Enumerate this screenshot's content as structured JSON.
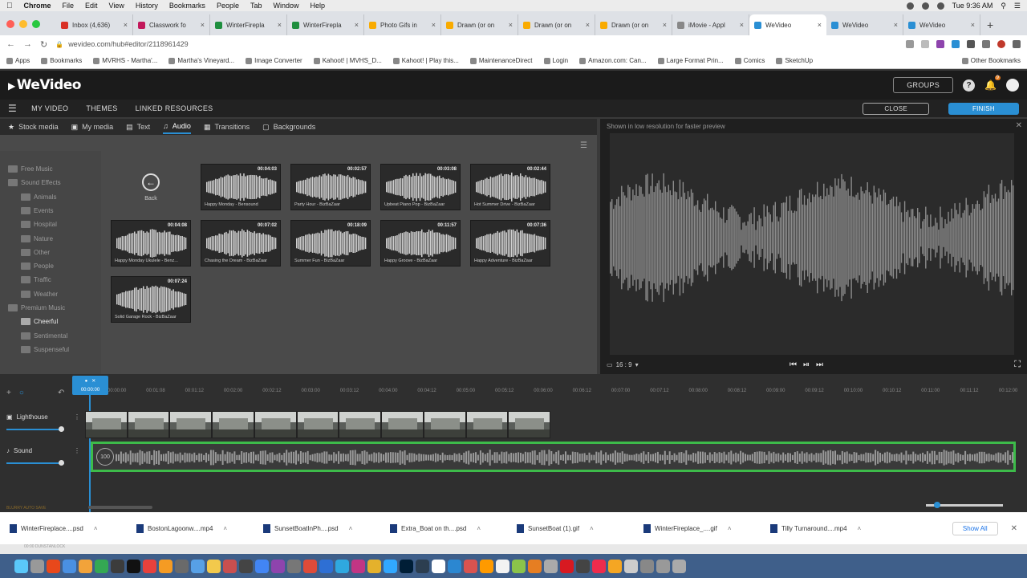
{
  "mac": {
    "app": "Chrome",
    "menus": [
      "File",
      "Edit",
      "View",
      "History",
      "Bookmarks",
      "People",
      "Tab",
      "Window",
      "Help"
    ],
    "clock": "Tue 9:36 AM"
  },
  "browser": {
    "tabs": [
      {
        "label": "Inbox (4,636)",
        "color": "#d93025"
      },
      {
        "label": "Classwork fo",
        "color": "#c2185b"
      },
      {
        "label": "WinterFirepla",
        "color": "#1e8e3e"
      },
      {
        "label": "WinterFirepla",
        "color": "#1e8e3e"
      },
      {
        "label": "Photo Gifs in",
        "color": "#f9ab00"
      },
      {
        "label": "Drawn (or on",
        "color": "#f9ab00"
      },
      {
        "label": "Drawn (or on",
        "color": "#f9ab00"
      },
      {
        "label": "Drawn (or on",
        "color": "#f9ab00"
      },
      {
        "label": "iMovie - Appl",
        "color": "#888888"
      },
      {
        "label": "WeVideo",
        "color": "#2a8fd4"
      },
      {
        "label": "WeVideo",
        "color": "#2a8fd4"
      },
      {
        "label": "WeVideo",
        "color": "#2a8fd4"
      }
    ],
    "active_tab": 9,
    "url": "wevideo.com/hub#editor/2118961429",
    "bookmarks": [
      "Apps",
      "Bookmarks",
      "MVRHS - Martha'...",
      "Martha's Vineyard...",
      "Image Converter",
      "Kahoot! | MVHS_D...",
      "Kahoot! | Play this...",
      "MaintenanceDirect",
      "Login",
      "Amazon.com: Can...",
      "Large Format Prin...",
      "Comics",
      "SketchUp"
    ],
    "other_bookmarks": "Other Bookmarks"
  },
  "wevideo": {
    "logo": "WeVideo",
    "groups": "GROUPS",
    "notif_count": "9",
    "nav": [
      "MY VIDEO",
      "THEMES",
      "LINKED RESOURCES"
    ],
    "close": "CLOSE",
    "finish": "FINISH",
    "media_tabs": [
      "Stock media",
      "My media",
      "Text",
      "Audio",
      "Transitions",
      "Backgrounds"
    ],
    "active_media_tab": "Audio",
    "folders": [
      {
        "label": "Free Music",
        "level": 0
      },
      {
        "label": "Sound Effects",
        "level": 0
      },
      {
        "label": "Animals",
        "level": 1
      },
      {
        "label": "Events",
        "level": 1
      },
      {
        "label": "Hospital",
        "level": 1
      },
      {
        "label": "Nature",
        "level": 1
      },
      {
        "label": "Other",
        "level": 1
      },
      {
        "label": "People",
        "level": 1
      },
      {
        "label": "Traffic",
        "level": 1
      },
      {
        "label": "Weather",
        "level": 1
      },
      {
        "label": "Premium Music",
        "level": 0
      },
      {
        "label": "Cheerful",
        "level": 1,
        "active": true
      },
      {
        "label": "Sentimental",
        "level": 1
      },
      {
        "label": "Suspenseful",
        "level": 1
      }
    ],
    "back_label": "Back",
    "audio_items": [
      {
        "title": "Happy Monday - Bensound",
        "duration": "00:04:03"
      },
      {
        "title": "Party Hour - BizBaZaar",
        "duration": "00:02:57"
      },
      {
        "title": "Upbeat Piano Pop - BizBaZaar",
        "duration": "00:03:08"
      },
      {
        "title": "Hot Summer Drive - BizBaZaar",
        "duration": "00:02:44"
      },
      {
        "title": "Happy Monday Ukulele - Benz...",
        "duration": "00:04:08"
      },
      {
        "title": "Chasing the Dream - BizBaZaar",
        "duration": "00:07:02"
      },
      {
        "title": "Summer Fun - BizBaZaar",
        "duration": "00:18:09"
      },
      {
        "title": "Happy Groove - BizBaZaar",
        "duration": "00:11:57"
      },
      {
        "title": "Happy Adventure - BizBaZaar",
        "duration": "00:07:36"
      },
      {
        "title": "Solid Garage Rock - BizBaZaar",
        "duration": "00:07:24"
      }
    ],
    "preview_note": "Shown in low resolution for faster preview",
    "aspect": "16 : 9",
    "timeline": {
      "playhead": "00:00:00",
      "ticks": [
        "00:00:00",
        "00:01:08",
        "00:01:12",
        "00:02:00",
        "00:02:12",
        "00:03:00",
        "00:03:12",
        "00:04:00",
        "00:04:12",
        "00:05:00",
        "00:05:12",
        "00:06:00",
        "00:06:12",
        "00:07:00",
        "00:07:12",
        "00:08:00",
        "00:08:12",
        "00:09:00",
        "00:09:12",
        "00:10:00",
        "00:10:12",
        "00:11:00",
        "00:11:12",
        "00:12:00"
      ],
      "tracks": [
        {
          "name": "Lighthouse"
        },
        {
          "name": "Sound"
        }
      ],
      "sound_level": "100",
      "status": "BLURRY AUTO SAVE"
    }
  },
  "downloads": [
    {
      "name": "WinterFireplace....psd"
    },
    {
      "name": "BostonLagoonw....mp4"
    },
    {
      "name": "SunsetBoatInPh....psd"
    },
    {
      "name": "Extra_Boat on th....psd"
    },
    {
      "name": "SunsetBoat (1).gif"
    },
    {
      "name": "WinterFireplace_....gif"
    },
    {
      "name": "Tilly Turnaround....mp4"
    }
  ],
  "show_all": "Show All",
  "dock": {
    "status_text": "00:00 DUNSTANLOCK",
    "icon_colors": [
      "#5ac8fa",
      "#999999",
      "#e8481b",
      "#4a90e2",
      "#f2a33a",
      "#34a853",
      "#3c3c3c",
      "#111111",
      "#e7413c",
      "#f59b23",
      "#6a6a6a",
      "#57a0e6",
      "#f2c94c",
      "#c94f4f",
      "#444444",
      "#4285f4",
      "#8e44ad",
      "#777777",
      "#dd4b39",
      "#2e6fd4",
      "#2fa8e0",
      "#c13584",
      "#e4b12c",
      "#31a8ff",
      "#001e36",
      "#2c3e50",
      "#ffffff",
      "#2b87d1",
      "#d9534f",
      "#ff9a00",
      "#f2f2f2",
      "#8bc34a",
      "#e67e22",
      "#aaaaaa",
      "#d71921",
      "#444444",
      "#ee2b4c",
      "#f5a623",
      "#cccccc",
      "#888888",
      "#999999",
      "#aaaaaa"
    ]
  }
}
